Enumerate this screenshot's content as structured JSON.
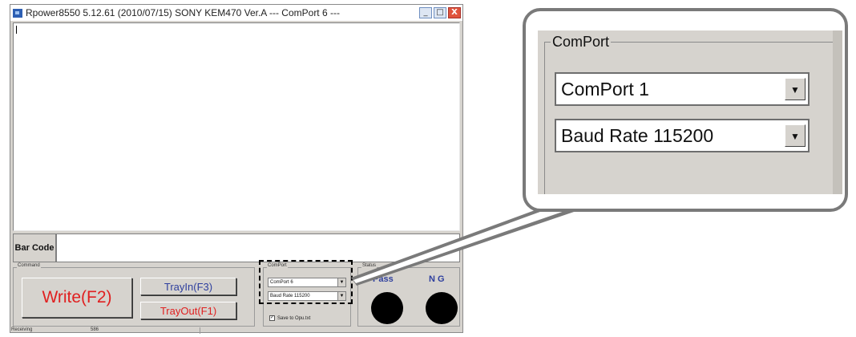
{
  "window": {
    "title": "Rpower8550  5.12.61  (2010/07/15)    SONY  KEM470  Ver.A  ---  ComPort  6  ---",
    "minimize_glyph": "_",
    "maximize_glyph": "□",
    "close_glyph": "X"
  },
  "barcode": {
    "label": "Bar Code",
    "value": ""
  },
  "command": {
    "group_label": "Command",
    "write_label": "Write(F2)",
    "trayin_label": "TrayIn(F3)",
    "trayout_label": "TrayOut(F1)"
  },
  "comport": {
    "group_label": "ComPort",
    "port_value": "ComPort 6",
    "baud_value": "Baud Rate 115200",
    "save_label": "Save to Opu.txt",
    "save_checked": true
  },
  "status": {
    "group_label": "Status",
    "pass_label": "Pass",
    "ng_label": "N G",
    "pass_color": "#000000",
    "ng_color": "#000000"
  },
  "statusbar": {
    "state": "Receiving",
    "value": "586"
  },
  "zoom": {
    "group_label": "ComPort",
    "port_value": "ComPort 1",
    "baud_value": "Baud Rate 115200"
  },
  "colors": {
    "accent_red": "#e02020",
    "accent_blue": "#2e3f9e",
    "face": "#d6d3ce"
  }
}
